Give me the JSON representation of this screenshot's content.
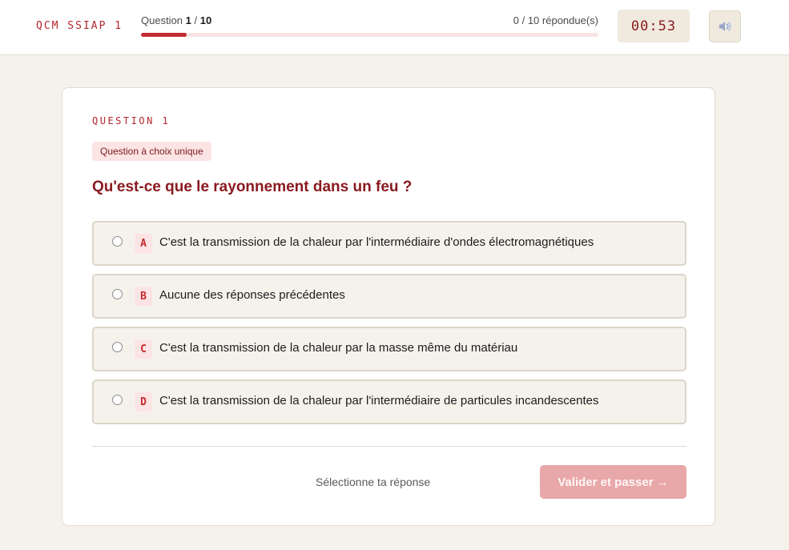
{
  "header": {
    "brand": "QCM SSIAP 1",
    "question_prefix": "Question ",
    "current": "1",
    "separator": " / ",
    "total": "10",
    "answered": "0 / 10 répondue(s)",
    "progress_fraction": 0.1,
    "timer": "00:53",
    "sound_icon": "speaker-icon"
  },
  "question": {
    "number_label": "QUESTION 1",
    "type_label": "Question à choix unique",
    "text": "Qu'est-ce que le rayonnement dans un feu ?",
    "options": [
      {
        "letter": "A",
        "text": "C'est la transmission de la chaleur par l'intermédiaire d'ondes électromagnétiques"
      },
      {
        "letter": "B",
        "text": "Aucune des réponses précédentes"
      },
      {
        "letter": "C",
        "text": "C'est la transmission de la chaleur par la masse même du matériau"
      },
      {
        "letter": "D",
        "text": "C'est la transmission de la chaleur par l'intermédiaire de particules incandescentes"
      }
    ]
  },
  "footer": {
    "hint": "Sélectionne ta réponse",
    "submit_label": "Valider et passer →"
  },
  "colors": {
    "accent": "#c42b31",
    "page_bg": "#f5f2ec"
  }
}
